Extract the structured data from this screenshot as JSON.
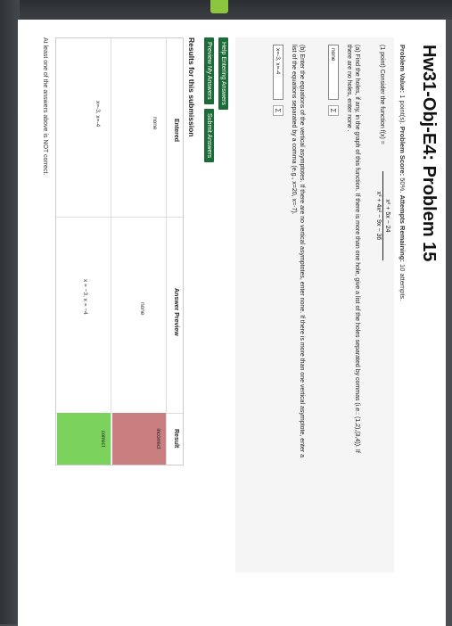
{
  "page": {
    "title": "Hw31-Obj-E4: Problem 15",
    "meta": {
      "problem_value_label": "Problem Value:",
      "problem_value": "1 point(s).",
      "score_label": "Problem Score:",
      "score": "50%.",
      "attempts_label": "Attempts Remaining:",
      "attempts": "10 attempts."
    }
  },
  "problem": {
    "intro": "(1 point) Consider the function f(x) =",
    "numerator": "x² + 5x − 24",
    "denominator": "x³ + 4x² − 9x − 36",
    "part_a_line1": "(a) Find the holes, if any, in the graph of this function. If there is more than one hole, give a list of the holes separated by commas (i.e.: (1,2),(3,4)). If",
    "part_a_line2": "there are no holes, enter none .",
    "part_a_value": "none",
    "part_b_line1": "(b) Enter the equations of the vertical asymptotes. If there are no vertical asymptotes, enter none. If there is more than one vertical asymptote, enter a",
    "part_b_line2": "list of the equations separated by a comma (e.g., x=20, x=-7).",
    "part_b_value": "x=-3, x=-4",
    "sigma_label": "Σ"
  },
  "buttons": {
    "help": "Help Entering Answers",
    "preview": "Preview My Answers",
    "submit": "Submit Answers"
  },
  "results": {
    "heading": "Results for this submission",
    "columns": [
      "Entered",
      "Answer Preview",
      "Result"
    ],
    "rows": [
      {
        "entered": "none",
        "preview": "none",
        "result": "incorrect"
      },
      {
        "entered": "x=-3, x=-4",
        "preview": "x = −3, x = −4",
        "result": "correct"
      }
    ],
    "footer": "At least one of the answers above is NOT correct."
  },
  "colors": {
    "incorrect": "#c97f80",
    "correct": "#7bd35d",
    "button": "#1e6b3a",
    "accent_tab": "#8cc63f"
  }
}
